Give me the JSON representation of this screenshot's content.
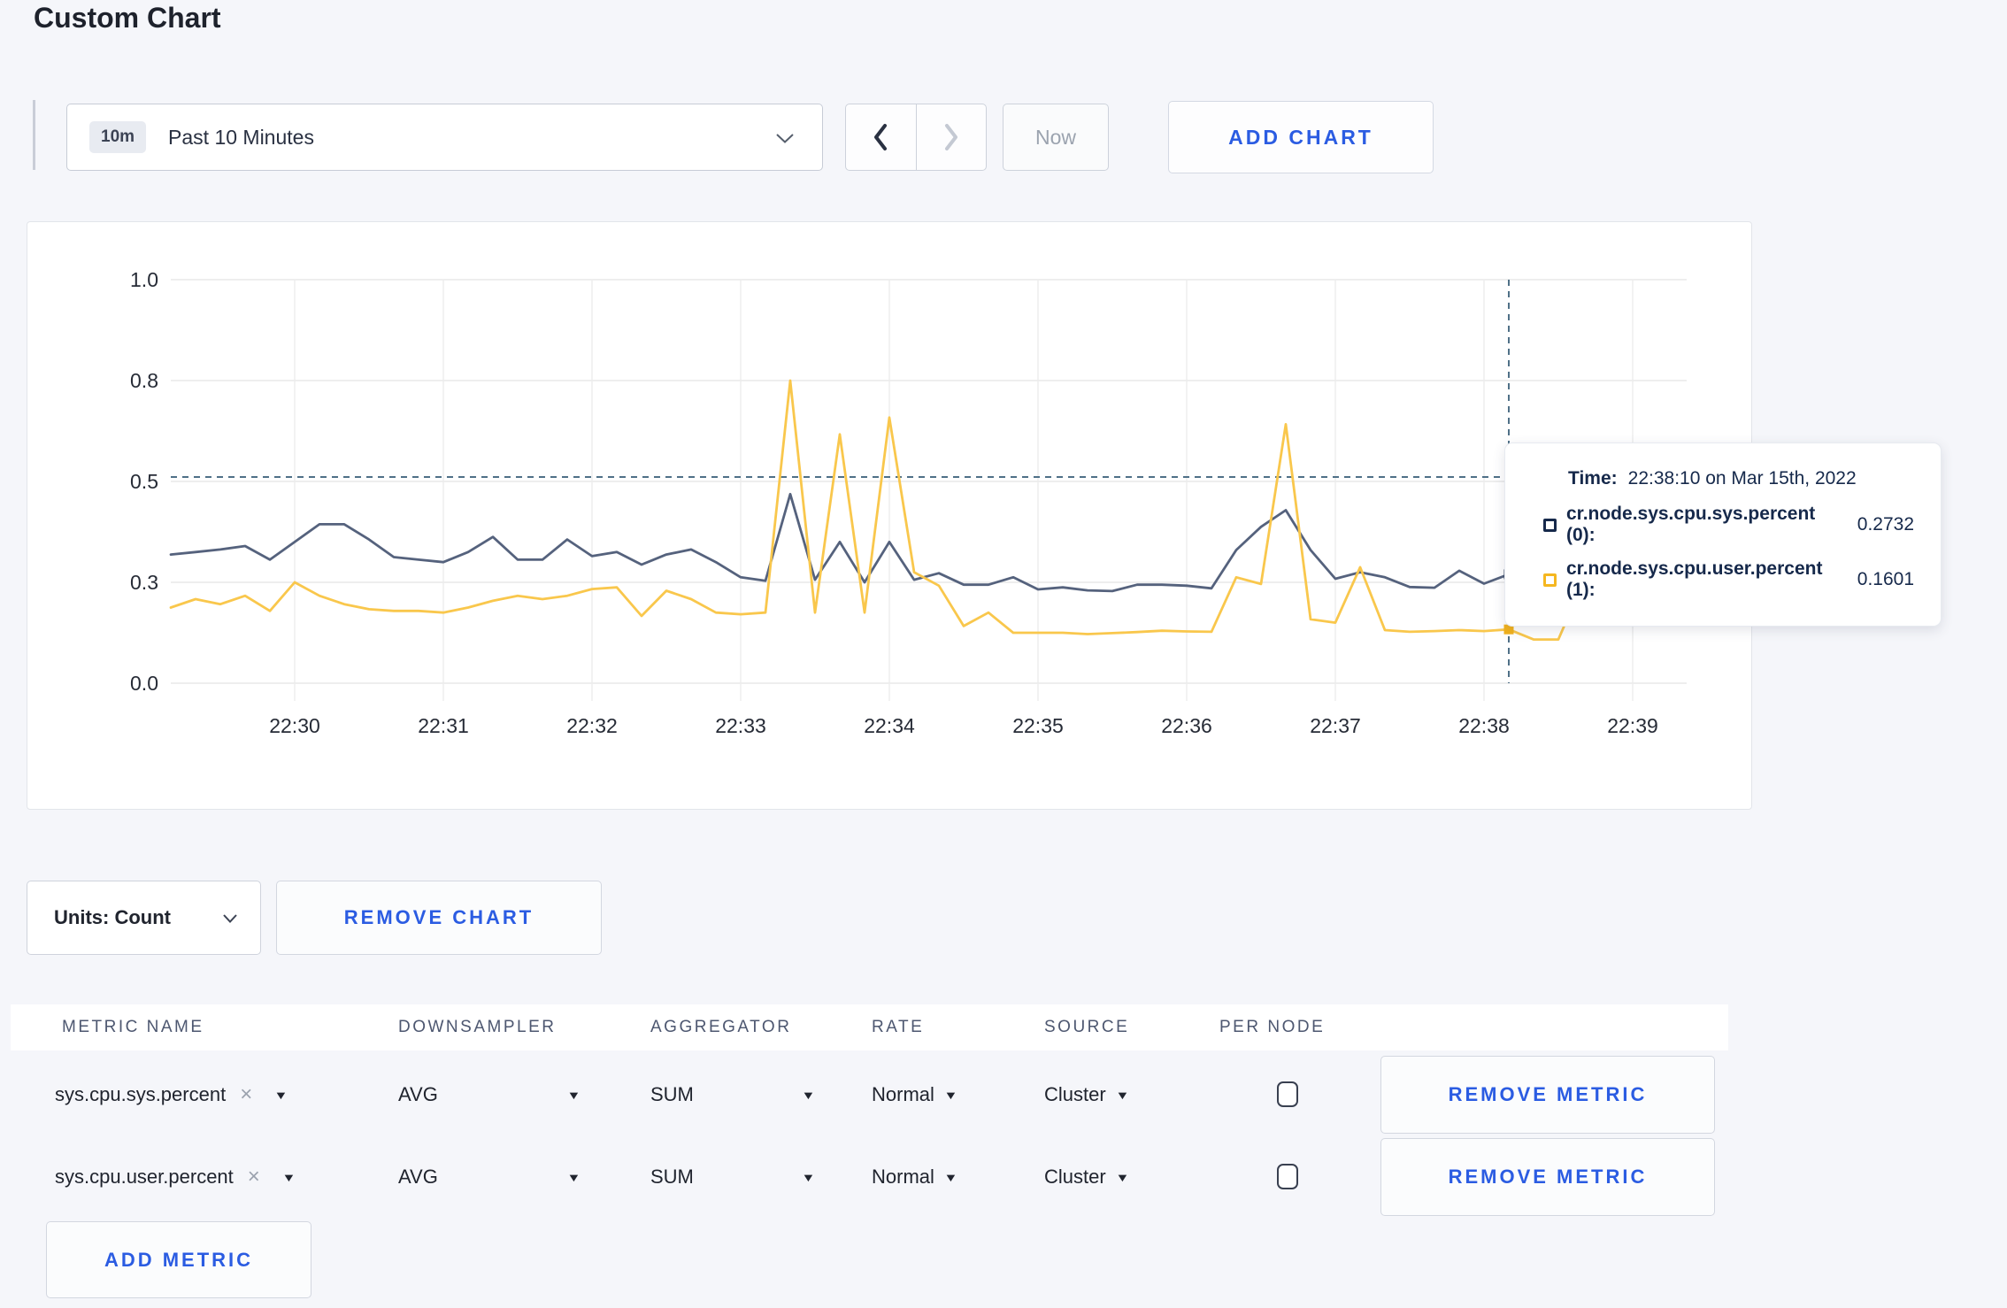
{
  "page": {
    "title": "Custom Chart"
  },
  "toolbar": {
    "range_badge": "10m",
    "range_label": "Past 10 Minutes",
    "now_label": "Now",
    "add_chart_label": "ADD CHART"
  },
  "icons": {
    "caret": "▼",
    "clear": "×"
  },
  "chart": {
    "tooltip": {
      "time_label": "Time:",
      "time_value": "22:38:10 on Mar 15th, 2022",
      "rows": [
        {
          "label": "cr.node.sys.cpu.sys.percent (0):",
          "value": "0.2732",
          "swatch_color": "#16294b"
        },
        {
          "label": "cr.node.sys.cpu.user.percent (1):",
          "value": "0.1601",
          "swatch_color": "#f5b720"
        }
      ]
    }
  },
  "chart_data": {
    "type": "line",
    "title": "",
    "xlabel": "",
    "ylabel": "",
    "x_start": "22:29:10",
    "x_end": "22:39:10",
    "x_step_seconds": 10,
    "x_ticks": [
      "22:30",
      "22:31",
      "22:32",
      "22:33",
      "22:34",
      "22:35",
      "22:36",
      "22:37",
      "22:38",
      "22:39"
    ],
    "y_tick_labels": [
      "0.0",
      "0.3",
      "0.5",
      "0.8",
      "1.0"
    ],
    "y_tick_values": [
      0,
      0.3,
      0.5,
      0.8,
      1.0
    ],
    "ylim": [
      0,
      1.0
    ],
    "grid": true,
    "legend_position": "tooltip",
    "series": [
      {
        "name": "cr.node.sys.cpu.sys.percent",
        "color": "#55627d",
        "marker_color": "#33415e",
        "values": [
          0.355,
          0.36,
          0.365,
          0.372,
          0.345,
          0.38,
          0.415,
          0.415,
          0.385,
          0.35,
          0.345,
          0.34,
          0.36,
          0.39,
          0.345,
          0.345,
          0.385,
          0.352,
          0.36,
          0.335,
          0.355,
          0.365,
          0.34,
          0.31,
          0.303,
          0.475,
          0.305,
          0.38,
          0.3,
          0.38,
          0.305,
          0.318,
          0.293,
          0.293,
          0.31,
          0.279,
          0.285,
          0.276,
          0.274,
          0.293,
          0.293,
          0.29,
          0.282,
          0.364,
          0.41,
          0.443,
          0.364,
          0.307,
          0.32,
          0.31,
          0.286,
          0.284,
          0.323,
          0.296,
          0.316,
          0.3,
          0.295,
          0.3,
          0.31,
          0.305,
          0.31
        ]
      },
      {
        "name": "cr.node.sys.cpu.user.percent",
        "color": "#f9c74c",
        "marker_color": "#f2b21c",
        "values": [
          0.225,
          0.25,
          0.235,
          0.26,
          0.215,
          0.3,
          0.26,
          0.235,
          0.22,
          0.215,
          0.215,
          0.21,
          0.225,
          0.245,
          0.26,
          0.25,
          0.26,
          0.28,
          0.285,
          0.2,
          0.275,
          0.25,
          0.21,
          0.205,
          0.21,
          0.8,
          0.21,
          0.64,
          0.21,
          0.69,
          0.32,
          0.29,
          0.17,
          0.21,
          0.15,
          0.15,
          0.15,
          0.146,
          0.149,
          0.152,
          0.156,
          0.154,
          0.153,
          0.31,
          0.295,
          0.67,
          0.19,
          0.18,
          0.33,
          0.158,
          0.153,
          0.155,
          0.158,
          0.155,
          0.16,
          0.13,
          0.13,
          0.3,
          0.36,
          0.19,
          0.27
        ]
      }
    ],
    "crosshair": {
      "index": 54,
      "time": "22:38:10",
      "hover_value": 0.513,
      "sys_value": 0.2732,
      "user_value": 0.1601
    }
  },
  "units": {
    "label": "Units: Count"
  },
  "chart_actions": {
    "remove_chart_label": "REMOVE CHART"
  },
  "metrics_table": {
    "headers": [
      "METRIC NAME",
      "DOWNSAMPLER",
      "AGGREGATOR",
      "RATE",
      "SOURCE",
      "PER NODE"
    ],
    "rows": [
      {
        "name": "sys.cpu.sys.percent",
        "downsampler": "AVG",
        "aggregator": "SUM",
        "rate": "Normal",
        "source": "Cluster",
        "per_node_checked": false
      },
      {
        "name": "sys.cpu.user.percent",
        "downsampler": "AVG",
        "aggregator": "SUM",
        "rate": "Normal",
        "source": "Cluster",
        "per_node_checked": false
      }
    ],
    "remove_metric_label": "REMOVE METRIC",
    "add_metric_label": "ADD METRIC"
  }
}
